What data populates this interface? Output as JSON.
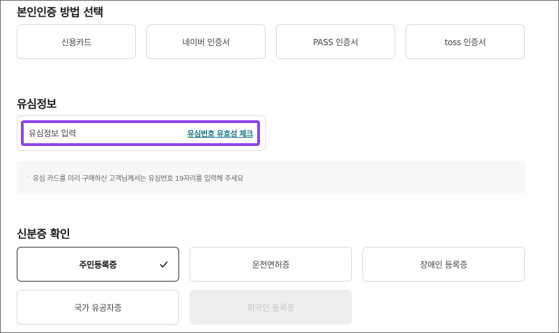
{
  "auth": {
    "title": "본인인증 방법 선택",
    "methods": [
      "신용카드",
      "네이버 인증서",
      "PASS 인증서",
      "toss 인증서"
    ]
  },
  "usim": {
    "title": "유심정보",
    "placeholder": "유심정보 입력",
    "check_link": "유심번호 유효성 체크",
    "highlight_color": "#8b44e8",
    "notice_bullet": "·",
    "notice": "유심 카드를 미리 구매하신 고객님께서는 유심번호 19자리를 입력해 주세요"
  },
  "id": {
    "title": "신분증 확인",
    "options": [
      {
        "label": "주민등록증",
        "state": "selected"
      },
      {
        "label": "운전면허증",
        "state": "normal"
      },
      {
        "label": "장애인 등록증",
        "state": "normal"
      },
      {
        "label": "국가 유공자증",
        "state": "normal"
      },
      {
        "label": "외국인 등록증",
        "state": "disabled"
      }
    ],
    "selected_icon": "check-icon"
  }
}
